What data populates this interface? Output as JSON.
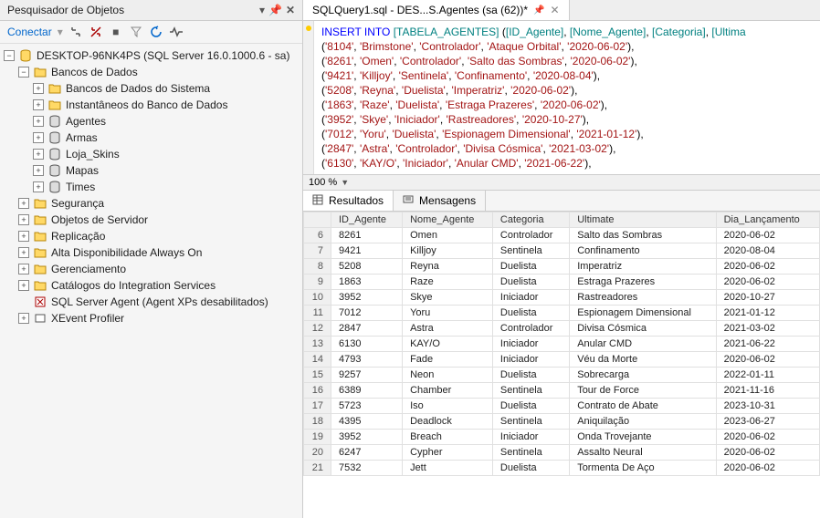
{
  "panel": {
    "title": "Pesquisador de Objetos",
    "connect": "Conectar"
  },
  "tree": {
    "server": "DESKTOP-96NK4PS (SQL Server 16.0.1000.6 - sa)",
    "nodes": [
      {
        "label": "Bancos de Dados",
        "depth": 1,
        "exp": "-",
        "icon": "folder"
      },
      {
        "label": "Bancos de Dados do Sistema",
        "depth": 2,
        "exp": "+",
        "icon": "folder"
      },
      {
        "label": "Instantâneos do Banco de Dados",
        "depth": 2,
        "exp": "+",
        "icon": "folder"
      },
      {
        "label": "Agentes",
        "depth": 2,
        "exp": "+",
        "icon": "db"
      },
      {
        "label": "Armas",
        "depth": 2,
        "exp": "+",
        "icon": "db"
      },
      {
        "label": "Loja_Skins",
        "depth": 2,
        "exp": "+",
        "icon": "db"
      },
      {
        "label": "Mapas",
        "depth": 2,
        "exp": "+",
        "icon": "db"
      },
      {
        "label": "Times",
        "depth": 2,
        "exp": "+",
        "icon": "db"
      },
      {
        "label": "Segurança",
        "depth": 1,
        "exp": "+",
        "icon": "folder"
      },
      {
        "label": "Objetos de Servidor",
        "depth": 1,
        "exp": "+",
        "icon": "folder"
      },
      {
        "label": "Replicação",
        "depth": 1,
        "exp": "+",
        "icon": "folder"
      },
      {
        "label": "Alta Disponibilidade Always On",
        "depth": 1,
        "exp": "+",
        "icon": "folder"
      },
      {
        "label": "Gerenciamento",
        "depth": 1,
        "exp": "+",
        "icon": "folder"
      },
      {
        "label": "Catálogos do Integration Services",
        "depth": 1,
        "exp": "+",
        "icon": "folder"
      },
      {
        "label": "SQL Server Agent (Agent XPs desabilitados)",
        "depth": 1,
        "exp": "",
        "icon": "agent"
      },
      {
        "label": "XEvent Profiler",
        "depth": 1,
        "exp": "+",
        "icon": "xevent"
      }
    ]
  },
  "tab": {
    "title": "SQLQuery1.sql - DES...S.Agentes (sa (62))*"
  },
  "sql": {
    "insert_kw": "INSERT INTO",
    "table": "[TABELA_AGENTES]",
    "cols": "([ID_Agente], [Nome_Agente], [Categoria], [Ultima",
    "rows": [
      [
        "'8104'",
        "'Brimstone'",
        "'Controlador'",
        "'Ataque Orbital'",
        "'2020-06-02'"
      ],
      [
        "'8261'",
        "'Omen'",
        "'Controlador'",
        "'Salto das Sombras'",
        "'2020-06-02'"
      ],
      [
        "'9421'",
        "'Killjoy'",
        "'Sentinela'",
        "'Confinamento'",
        "'2020-08-04'"
      ],
      [
        "'5208'",
        "'Reyna'",
        "'Duelista'",
        "'Imperatriz'",
        "'2020-06-02'"
      ],
      [
        "'1863'",
        "'Raze'",
        "'Duelista'",
        "'Estraga Prazeres'",
        "'2020-06-02'"
      ],
      [
        "'3952'",
        "'Skye'",
        "'Iniciador'",
        "'Rastreadores'",
        "'2020-10-27'"
      ],
      [
        "'7012'",
        "'Yoru'",
        "'Duelista'",
        "'Espionagem Dimensional'",
        "'2021-01-12'"
      ],
      [
        "'2847'",
        "'Astra'",
        "'Controlador'",
        "'Divisa Cósmica'",
        "'2021-03-02'"
      ],
      [
        "'6130'",
        "'KAY/O'",
        "'Iniciador'",
        "'Anular CMD'",
        "'2021-06-22'"
      ]
    ]
  },
  "zoom": "100 %",
  "result_tabs": {
    "results": "Resultados",
    "messages": "Mensagens"
  },
  "grid": {
    "headers": [
      "",
      "ID_Agente",
      "Nome_Agente",
      "Categoria",
      "Ultimate",
      "Dia_Lançamento"
    ],
    "rows": [
      [
        "6",
        "8261",
        "Omen",
        "Controlador",
        "Salto das Sombras",
        "2020-06-02"
      ],
      [
        "7",
        "9421",
        "Killjoy",
        "Sentinela",
        "Confinamento",
        "2020-08-04"
      ],
      [
        "8",
        "5208",
        "Reyna",
        "Duelista",
        "Imperatriz",
        "2020-06-02"
      ],
      [
        "9",
        "1863",
        "Raze",
        "Duelista",
        "Estraga Prazeres",
        "2020-06-02"
      ],
      [
        "10",
        "3952",
        "Skye",
        "Iniciador",
        "Rastreadores",
        "2020-10-27"
      ],
      [
        "11",
        "7012",
        "Yoru",
        "Duelista",
        "Espionagem Dimensional",
        "2021-01-12"
      ],
      [
        "12",
        "2847",
        "Astra",
        "Controlador",
        "Divisa Cósmica",
        "2021-03-02"
      ],
      [
        "13",
        "6130",
        "KAY/O",
        "Iniciador",
        "Anular CMD",
        "2021-06-22"
      ],
      [
        "14",
        "4793",
        "Fade",
        "Iniciador",
        "Véu da Morte",
        "2020-06-02"
      ],
      [
        "15",
        "9257",
        "Neon",
        "Duelista",
        "Sobrecarga",
        "2022-01-11"
      ],
      [
        "16",
        "6389",
        "Chamber",
        "Sentinela",
        "Tour de Force",
        "2021-11-16"
      ],
      [
        "17",
        "5723",
        "Iso",
        "Duelista",
        "Contrato de Abate",
        "2023-10-31"
      ],
      [
        "18",
        "4395",
        "Deadlock",
        "Sentinela",
        "Aniquilação",
        "2023-06-27"
      ],
      [
        "19",
        "3952",
        "Breach",
        "Iniciador",
        "Onda Trovejante",
        "2020-06-02"
      ],
      [
        "20",
        "6247",
        "Cypher",
        "Sentinela",
        "Assalto Neural",
        "2020-06-02"
      ],
      [
        "21",
        "7532",
        "Jett",
        "Duelista",
        "Tormenta De Aço",
        "2020-06-02"
      ]
    ]
  }
}
